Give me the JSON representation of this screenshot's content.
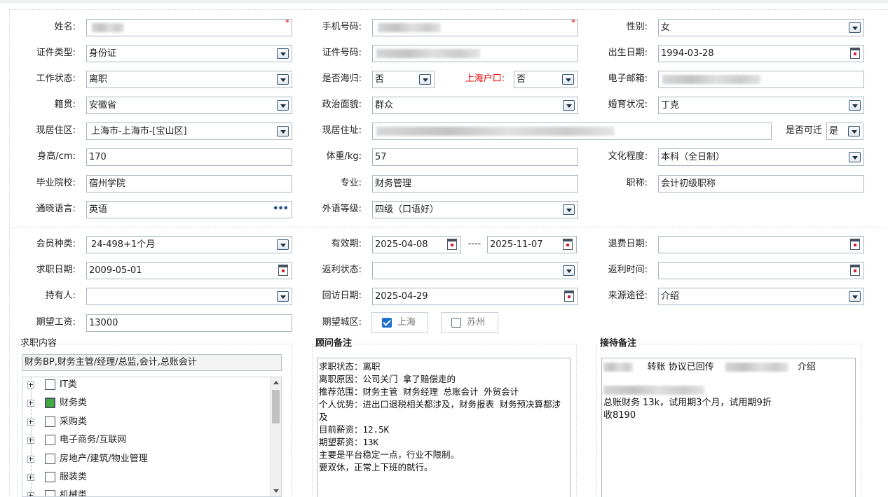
{
  "personal": {
    "name_label": "姓名:",
    "phone_label": "手机号码:",
    "gender_label": "性别:",
    "gender_value": "女",
    "id_type_label": "证件类型:",
    "id_type_value": "身份证",
    "id_number_label": "证件号码:",
    "birth_label": "出生日期:",
    "birth_value": "1994-03-28",
    "work_status_label": "工作状态:",
    "work_status_value": "离职",
    "returnee_label": "是否海归:",
    "returnee_value": "否",
    "shanghai_hukou_label": "上海户口:",
    "shanghai_hukou_value": "否",
    "email_label": "电子邮箱:",
    "native_label": "籍贯:",
    "native_value": "安徽省",
    "political_label": "政治面貌:",
    "political_value": "群众",
    "marital_label": "婚育状况:",
    "marital_value": "丁克",
    "residence_area_label": "现居住区:",
    "residence_area_value": "上海市-上海市-[宝山区]",
    "address_label": "现居住址:",
    "relocate_label": "是否可迁",
    "relocate_value": "是",
    "height_label": "身高/cm:",
    "height_value": "170",
    "weight_label": "体重/kg:",
    "weight_value": "57",
    "education_label": "文化程度:",
    "education_value": "本科（全日制）",
    "school_label": "毕业院校:",
    "school_value": "宿州学院",
    "major_label": "专业:",
    "major_value": "财务管理",
    "title_label": "职称:",
    "title_value": "会计初级职称",
    "language_label": "通晓语言:",
    "language_value": "英语",
    "language_level_label": "外语等级:",
    "language_level_value": "四级（口语好）"
  },
  "membership": {
    "member_type_label": "会员种类:",
    "member_type_value": "24-498+1个月",
    "validity_label": "有效期:",
    "validity_start": "2025-04-08",
    "validity_sep": "----",
    "validity_end": "2025-11-07",
    "refund_date_label": "退费日期:",
    "job_date_label": "求职日期:",
    "job_date_value": "2009-05-01",
    "rebate_status_label": "返利状态:",
    "rebate_time_label": "返利时间:",
    "holder_label": "持有人:",
    "visit_date_label": "回访日期:",
    "visit_date_value": "2025-04-29",
    "source_label": "来源途径:",
    "source_value": "介绍",
    "salary_label": "期望工资:",
    "salary_value": "13000",
    "city_label": "期望城区:",
    "cities": [
      {
        "label": "上海",
        "checked": true
      },
      {
        "label": "苏州",
        "checked": false
      }
    ]
  },
  "job_intent": {
    "title": "求职内容",
    "summary": "财务BP,财务主管/经理/总监,会计,总账会计",
    "tree": [
      {
        "label": "IT类",
        "checked": false
      },
      {
        "label": "财务类",
        "checked": true
      },
      {
        "label": "采购类",
        "checked": false
      },
      {
        "label": "电子商务/互联网",
        "checked": false
      },
      {
        "label": "房地产/建筑/物业管理",
        "checked": false
      },
      {
        "label": "服装类",
        "checked": false
      },
      {
        "label": "机械类",
        "checked": false
      }
    ]
  },
  "advisor_notes": {
    "title": "顾问备注",
    "text": "求职状态：离职\n离职原因：公司关门 拿了赔偿走的\n推荐范围：财务主管 财务经理 总账会计 外贸会计\n个人优势：进出口退税相关都涉及，财务报表 财务预决算都涉及\n目前薪资：12.5K\n期望薪资：13K\n主要是平台稳定一点，行业不限制。\n要双休，正常上下班的就行。"
  },
  "reception_notes": {
    "title": "接待备注",
    "line1_a": "转账 协议已回传",
    "line1_b": "介绍",
    "line3": "总账财务 13k，试用期3个月，试用期9折",
    "line4": "收8190"
  },
  "colors": {
    "required_star": "#e00000",
    "checked_blue": "#1f6fd1",
    "tree_checked_green": "#3faa3f"
  }
}
